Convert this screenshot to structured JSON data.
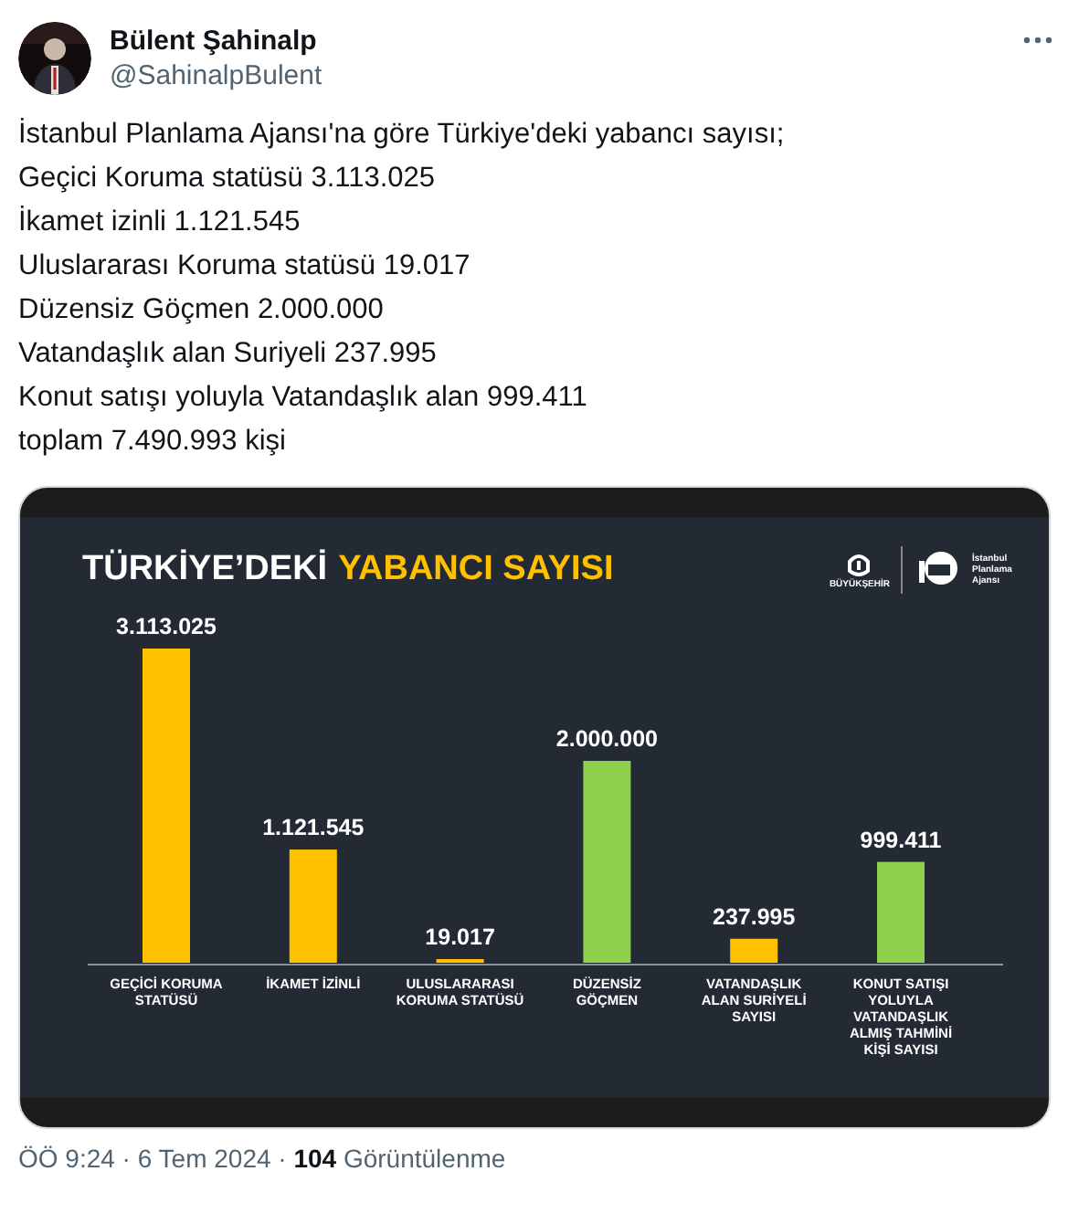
{
  "author": {
    "name": "Bülent Şahinalp",
    "handle": "@SahinalpBulent"
  },
  "text_lines": [
    "İstanbul Planlama Ajansı'na göre Türkiye'deki yabancı sayısı;",
    "Geçici Koruma statüsü 3.113.025",
    "İkamet izinli 1.121.545",
    "Uluslararası Koruma statüsü 19.017",
    "Düzensiz Göçmen 2.000.000",
    "Vatandaşlık alan Suriyeli 237.995",
    "Konut satışı yoluyla Vatandaşlık alan 999.411",
    "toplam 7.490.993 kişi"
  ],
  "infographic": {
    "title_part_1": "TÜRKİYE’DEKİ",
    "title_part_2": "YABANCI SAYISI",
    "logo_1_text": "BÜYÜKŞEHİR",
    "logo_2_text": "İstanbul Planlama Ajansı",
    "chart_data": {
      "type": "bar",
      "stacked": true,
      "data_labels": true,
      "categories": [
        "GEÇİCİ KORUMA STATÜSÜ",
        "İKAMET İZİNLİ",
        "ULUSLARARASI KORUMA STATÜSÜ",
        "DÜZENSİZ GÖÇMEN",
        "VATANDAŞLIK ALAN SURİYELİ SAYISI",
        "KONUT SATIŞI YOLUYLA VATANDAŞLIK ALMIŞ TAHMİNİ KİŞİ SAYISI"
      ],
      "series": [
        {
          "color": "#ffc000",
          "values": [
            3113025,
            1121545,
            19017,
            null,
            237995,
            null
          ],
          "value_labels": [
            "3.113.025",
            "1.121.545",
            "19.017",
            null,
            "237.995",
            null
          ]
        },
        {
          "color": "#8fd14f",
          "values": [
            null,
            null,
            null,
            2000000,
            null,
            999411
          ],
          "value_labels": [
            null,
            null,
            null,
            "2.000.000",
            null,
            "999.411"
          ]
        }
      ]
    }
  },
  "footer": "ÖÖ 9:24 · 6 Tem 2024 · **104** Görüntülenme"
}
